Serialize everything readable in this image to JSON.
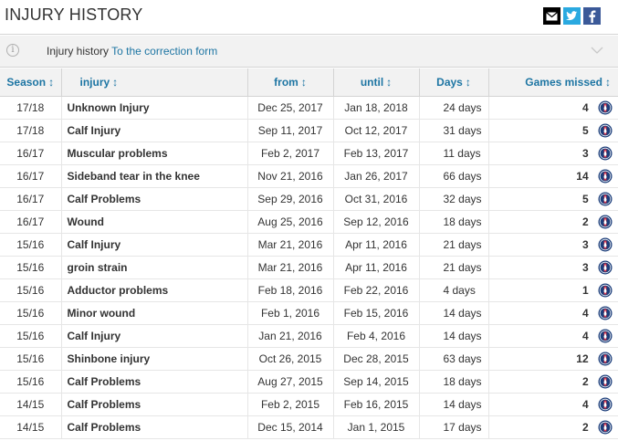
{
  "header": {
    "title": "INJURY HISTORY",
    "share_icons": [
      "mail-icon",
      "twitter-icon",
      "facebook-icon"
    ]
  },
  "infobar": {
    "text": "Injury history",
    "link": "To the correction form"
  },
  "table": {
    "columns": {
      "season": "Season",
      "injury": "injury",
      "from": "from",
      "until": "until",
      "days": "Days",
      "games": "Games missed"
    },
    "rows": [
      {
        "season": "17/18",
        "injury": "Unknown Injury",
        "from": "Dec 25, 2017",
        "until": "Jan 18, 2018",
        "days": "24 days",
        "games": "4"
      },
      {
        "season": "17/18",
        "injury": "Calf Injury",
        "from": "Sep 11, 2017",
        "until": "Oct 12, 2017",
        "days": "31 days",
        "games": "5"
      },
      {
        "season": "16/17",
        "injury": "Muscular problems",
        "from": "Feb 2, 2017",
        "until": "Feb 13, 2017",
        "days": "11 days",
        "games": "3"
      },
      {
        "season": "16/17",
        "injury": "Sideband tear in the knee",
        "from": "Nov 21, 2016",
        "until": "Jan 26, 2017",
        "days": "66 days",
        "games": "14"
      },
      {
        "season": "16/17",
        "injury": "Calf Problems",
        "from": "Sep 29, 2016",
        "until": "Oct 31, 2016",
        "days": "32 days",
        "games": "5"
      },
      {
        "season": "16/17",
        "injury": "Wound",
        "from": "Aug 25, 2016",
        "until": "Sep 12, 2016",
        "days": "18 days",
        "games": "2"
      },
      {
        "season": "15/16",
        "injury": "Calf Injury",
        "from": "Mar 21, 2016",
        "until": "Apr 11, 2016",
        "days": "21 days",
        "games": "3"
      },
      {
        "season": "15/16",
        "injury": "groin strain",
        "from": "Mar 21, 2016",
        "until": "Apr 11, 2016",
        "days": "21 days",
        "games": "3"
      },
      {
        "season": "15/16",
        "injury": "Adductor problems",
        "from": "Feb 18, 2016",
        "until": "Feb 22, 2016",
        "days": "4 days",
        "games": "1"
      },
      {
        "season": "15/16",
        "injury": "Minor wound",
        "from": "Feb 1, 2016",
        "until": "Feb 15, 2016",
        "days": "14 days",
        "games": "4"
      },
      {
        "season": "15/16",
        "injury": "Calf Injury",
        "from": "Jan 21, 2016",
        "until": "Feb 4, 2016",
        "days": "14 days",
        "games": "4"
      },
      {
        "season": "15/16",
        "injury": "Shinbone injury",
        "from": "Oct 26, 2015",
        "until": "Dec 28, 2015",
        "days": "63 days",
        "games": "12"
      },
      {
        "season": "15/16",
        "injury": "Calf Problems",
        "from": "Aug 27, 2015",
        "until": "Sep 14, 2015",
        "days": "18 days",
        "games": "2"
      },
      {
        "season": "14/15",
        "injury": "Calf Problems",
        "from": "Feb 2, 2015",
        "until": "Feb 16, 2015",
        "days": "14 days",
        "games": "4"
      },
      {
        "season": "14/15",
        "injury": "Calf Problems",
        "from": "Dec 15, 2014",
        "until": "Jan 1, 2015",
        "days": "17 days",
        "games": "2"
      }
    ]
  },
  "colors": {
    "link": "#1d75a3",
    "header_bg": "#f2f2f2",
    "club_badge": "#1b3d7a"
  }
}
